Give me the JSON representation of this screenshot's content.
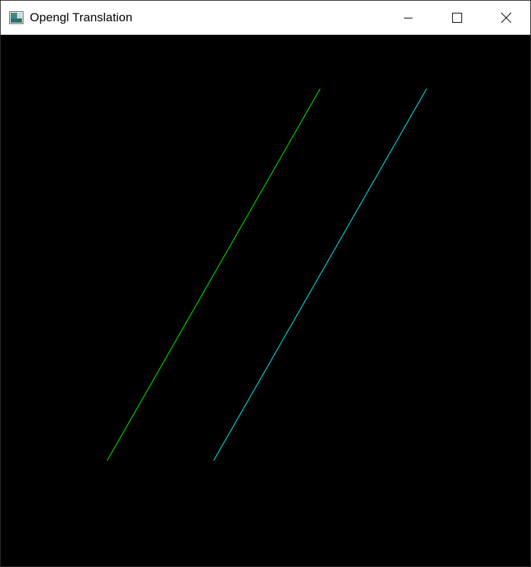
{
  "window": {
    "title": "Opengl Translation"
  },
  "icons": {
    "app": "app-window-icon",
    "minimize": "minimize-icon",
    "maximize": "maximize-icon",
    "close": "close-icon"
  },
  "scene": {
    "background_color": "#000000",
    "lines": [
      {
        "name": "original-line",
        "color": "#00c800"
      },
      {
        "name": "translated-line",
        "color": "#00c8c8"
      }
    ]
  }
}
